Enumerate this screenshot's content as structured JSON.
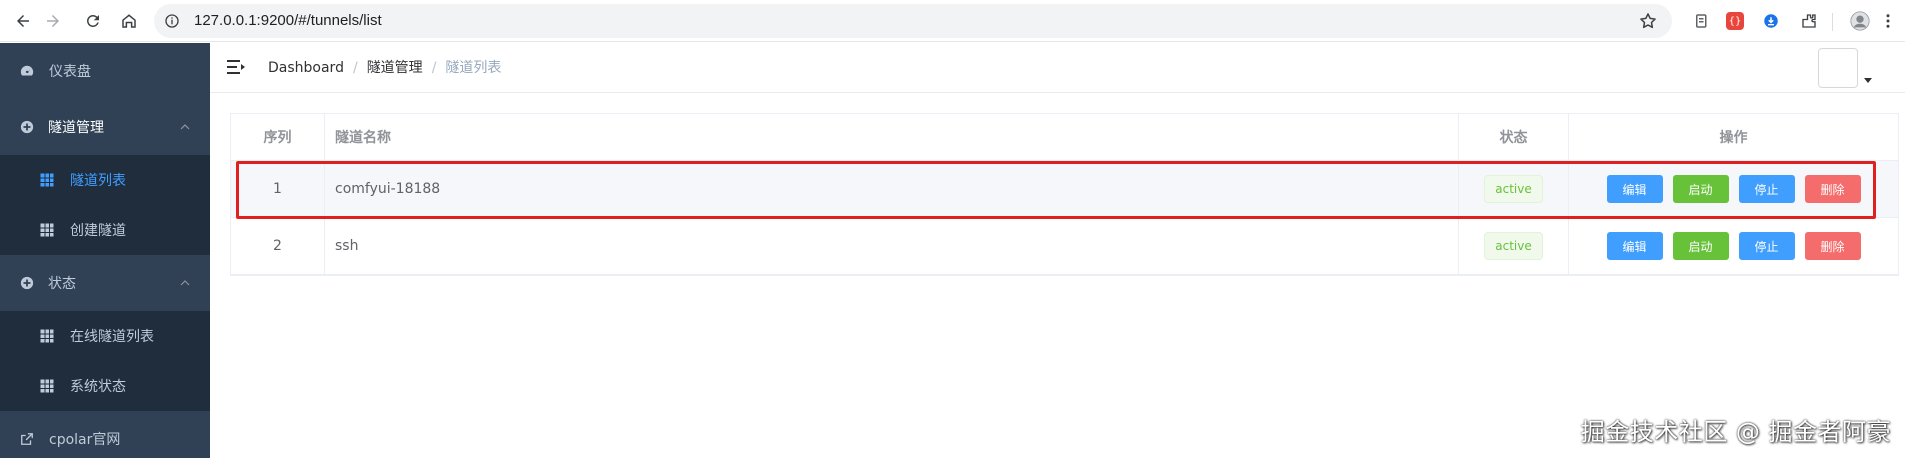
{
  "browser": {
    "url": "127.0.0.1:9200/#/tunnels/list",
    "extensions": [
      {
        "name": "tab-search-icon",
        "color": "#5f6368"
      },
      {
        "name": "extension-red-icon",
        "color": "#e8453c"
      },
      {
        "name": "extension-blue-icon",
        "color": "#1a73e8"
      },
      {
        "name": "puzzle-icon",
        "color": "#5f6368"
      }
    ]
  },
  "sidebar": {
    "dashboard": "仪表盘",
    "tunnel_mgmt": "隧道管理",
    "tunnel_list": "隧道列表",
    "create_tunnel": "创建隧道",
    "status": "状态",
    "online_tunnels": "在线隧道列表",
    "system_status": "系统状态",
    "cpolar_site": "cpolar官网",
    "active_color": "#409eff"
  },
  "breadcrumb": {
    "home": "Dashboard",
    "sep1": "/",
    "section": "隧道管理",
    "sep2": "/",
    "current": "隧道列表"
  },
  "table": {
    "headers": {
      "index": "序列",
      "name": "隧道名称",
      "status": "状态",
      "actions": "操作"
    },
    "rows": [
      {
        "index": "1",
        "name": "comfyui-18188",
        "status": "active"
      },
      {
        "index": "2",
        "name": "ssh",
        "status": "active"
      }
    ],
    "buttons": {
      "edit": "编辑",
      "start": "启动",
      "stop": "停止",
      "delete": "删除"
    }
  },
  "watermark": "掘金技术社区 @ 掘金者阿豪"
}
